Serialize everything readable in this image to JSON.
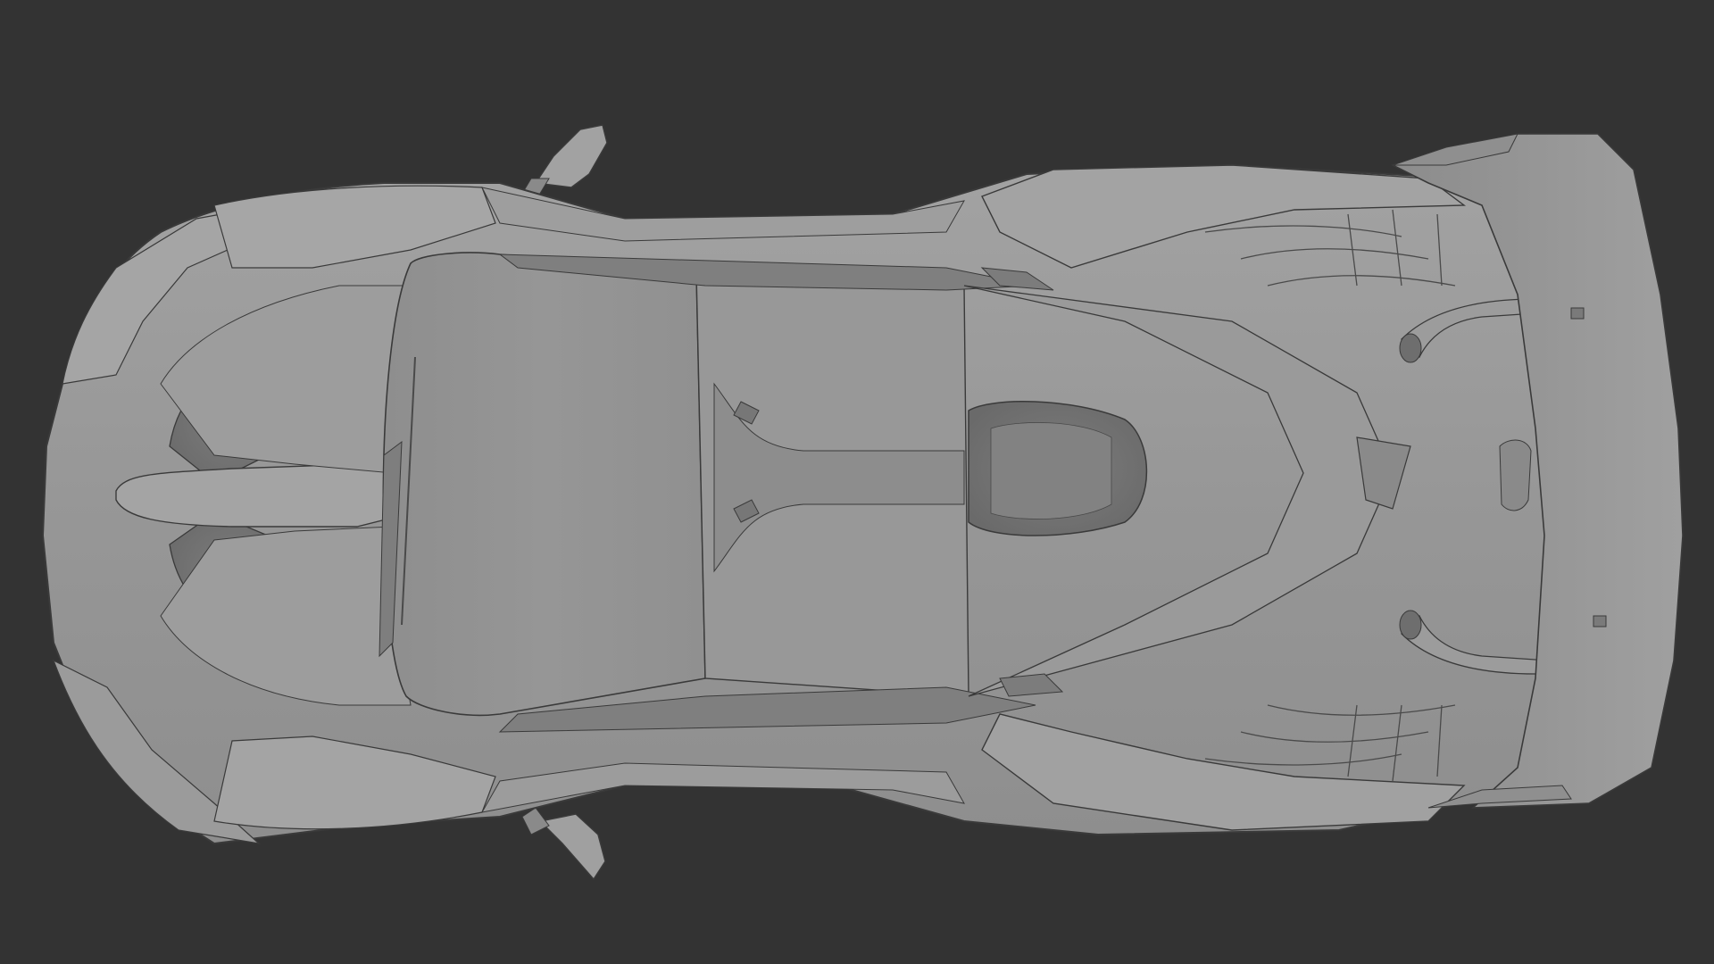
{
  "scene": {
    "subject": "clay-render-supercar-top-view",
    "colors": {
      "background": "#333333",
      "clay_base": "#9a9a9a",
      "clay_light": "#a8a8a8",
      "clay_mid": "#8f8f8f",
      "clay_dark": "#7a7a7a",
      "clay_shadow": "#6c6c6c",
      "edge_line": "#3a3a3a"
    }
  }
}
